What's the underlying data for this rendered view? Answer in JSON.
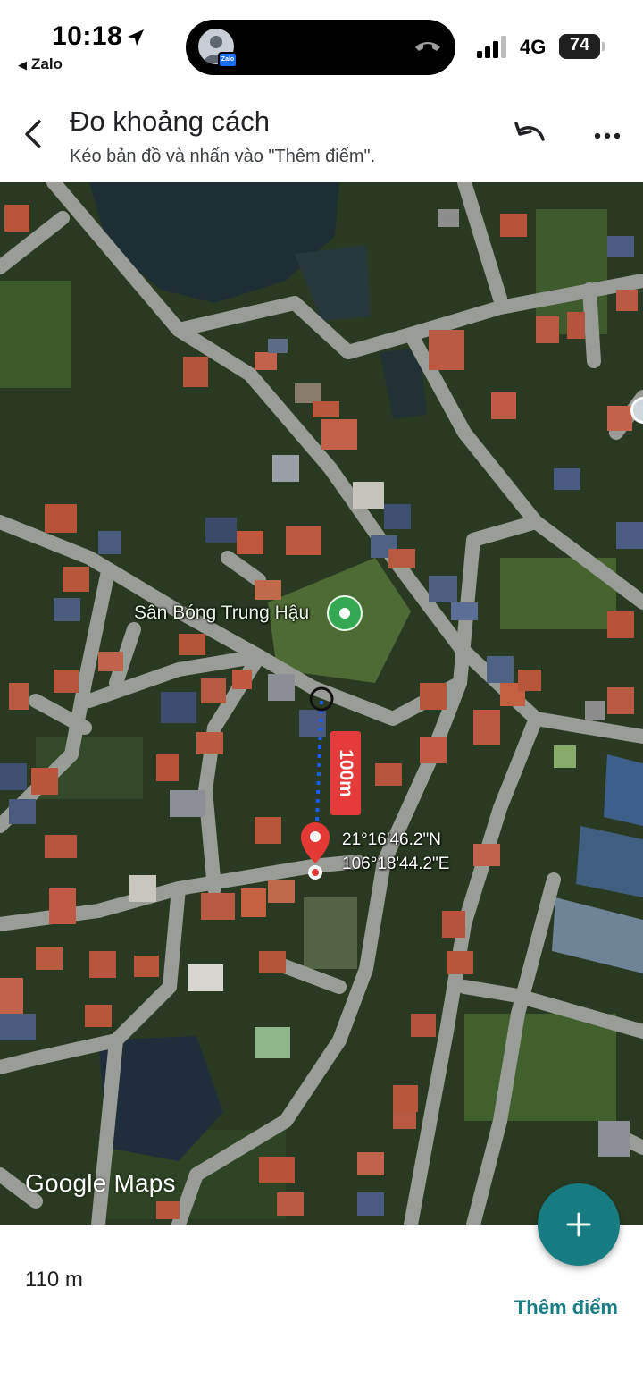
{
  "status_bar": {
    "time": "10:18",
    "back_app": "Zalo",
    "network": "4G",
    "battery": "74",
    "island_badge": "Zalo"
  },
  "header": {
    "title": "Đo khoảng cách",
    "subtitle": "Kéo bản đồ và nhấn vào \"Thêm điểm\"."
  },
  "map": {
    "place_name": "Sân Bóng Trung Hậu",
    "segment_distance": "100m",
    "latitude": "21°16'46.2\"N",
    "longitude": "106°18'44.2\"E",
    "attribution": "Google Maps"
  },
  "bottom": {
    "total_distance": "110 m",
    "add_point_label": "Thêm điểm"
  },
  "icons": {
    "back": "chevron-left-icon",
    "undo": "undo-icon",
    "more": "more-horizontal-icon",
    "add": "plus-icon",
    "place": "place-pin-icon",
    "location": "location-arrow-icon"
  },
  "colors": {
    "accent": "#167c82",
    "measure_line": "#1a5cff",
    "distance_badge": "#e63b3b",
    "place_pin": "#34a853",
    "map_road": "#9a9c98"
  }
}
